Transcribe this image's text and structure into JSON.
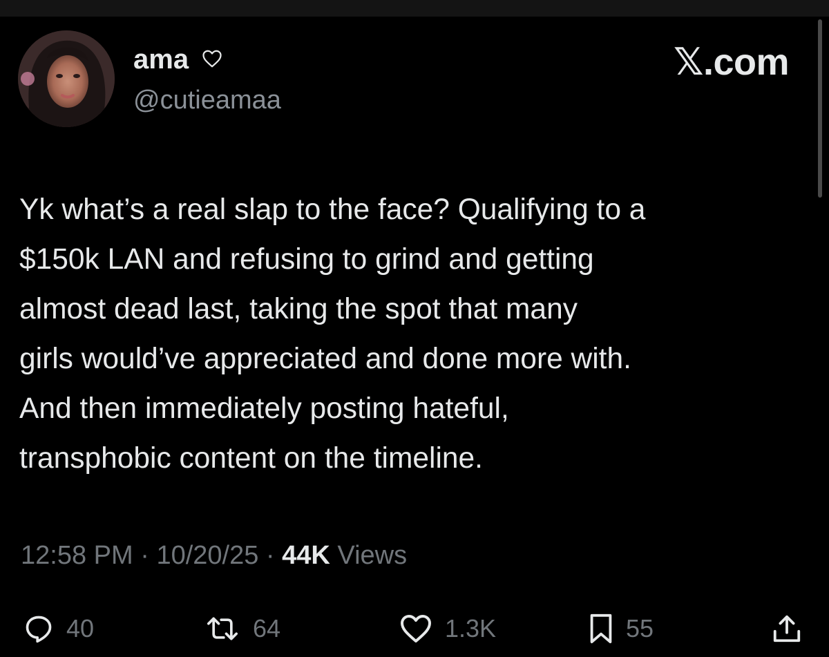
{
  "author": {
    "display_name": "ama",
    "name_badge": "♡",
    "handle": "@cutieamaa",
    "avatar_icon": "profile-photo"
  },
  "brand": {
    "x_glyph": "𝕏",
    "suffix": ".com"
  },
  "tweet": {
    "lines": [
      "Yk what’s a real slap to the face? Qualifying to a",
      "$150k LAN and refusing to grind and getting",
      "almost dead last, taking the spot that many",
      "girls would’ve appreciated and done more with.",
      "And then immediately posting hateful,",
      "transphobic content on the timeline."
    ]
  },
  "meta": {
    "time": "12:58 PM",
    "sep1": " · ",
    "date": "10/20/25",
    "sep2": " · ",
    "views_count": "44K",
    "views_label": " Views"
  },
  "actions": {
    "replies": "40",
    "reposts": "64",
    "likes": "1.3K",
    "bookmarks": "55"
  },
  "colors": {
    "background": "#000000",
    "text_primary": "#e7e9ea",
    "text_secondary": "#71767b"
  }
}
